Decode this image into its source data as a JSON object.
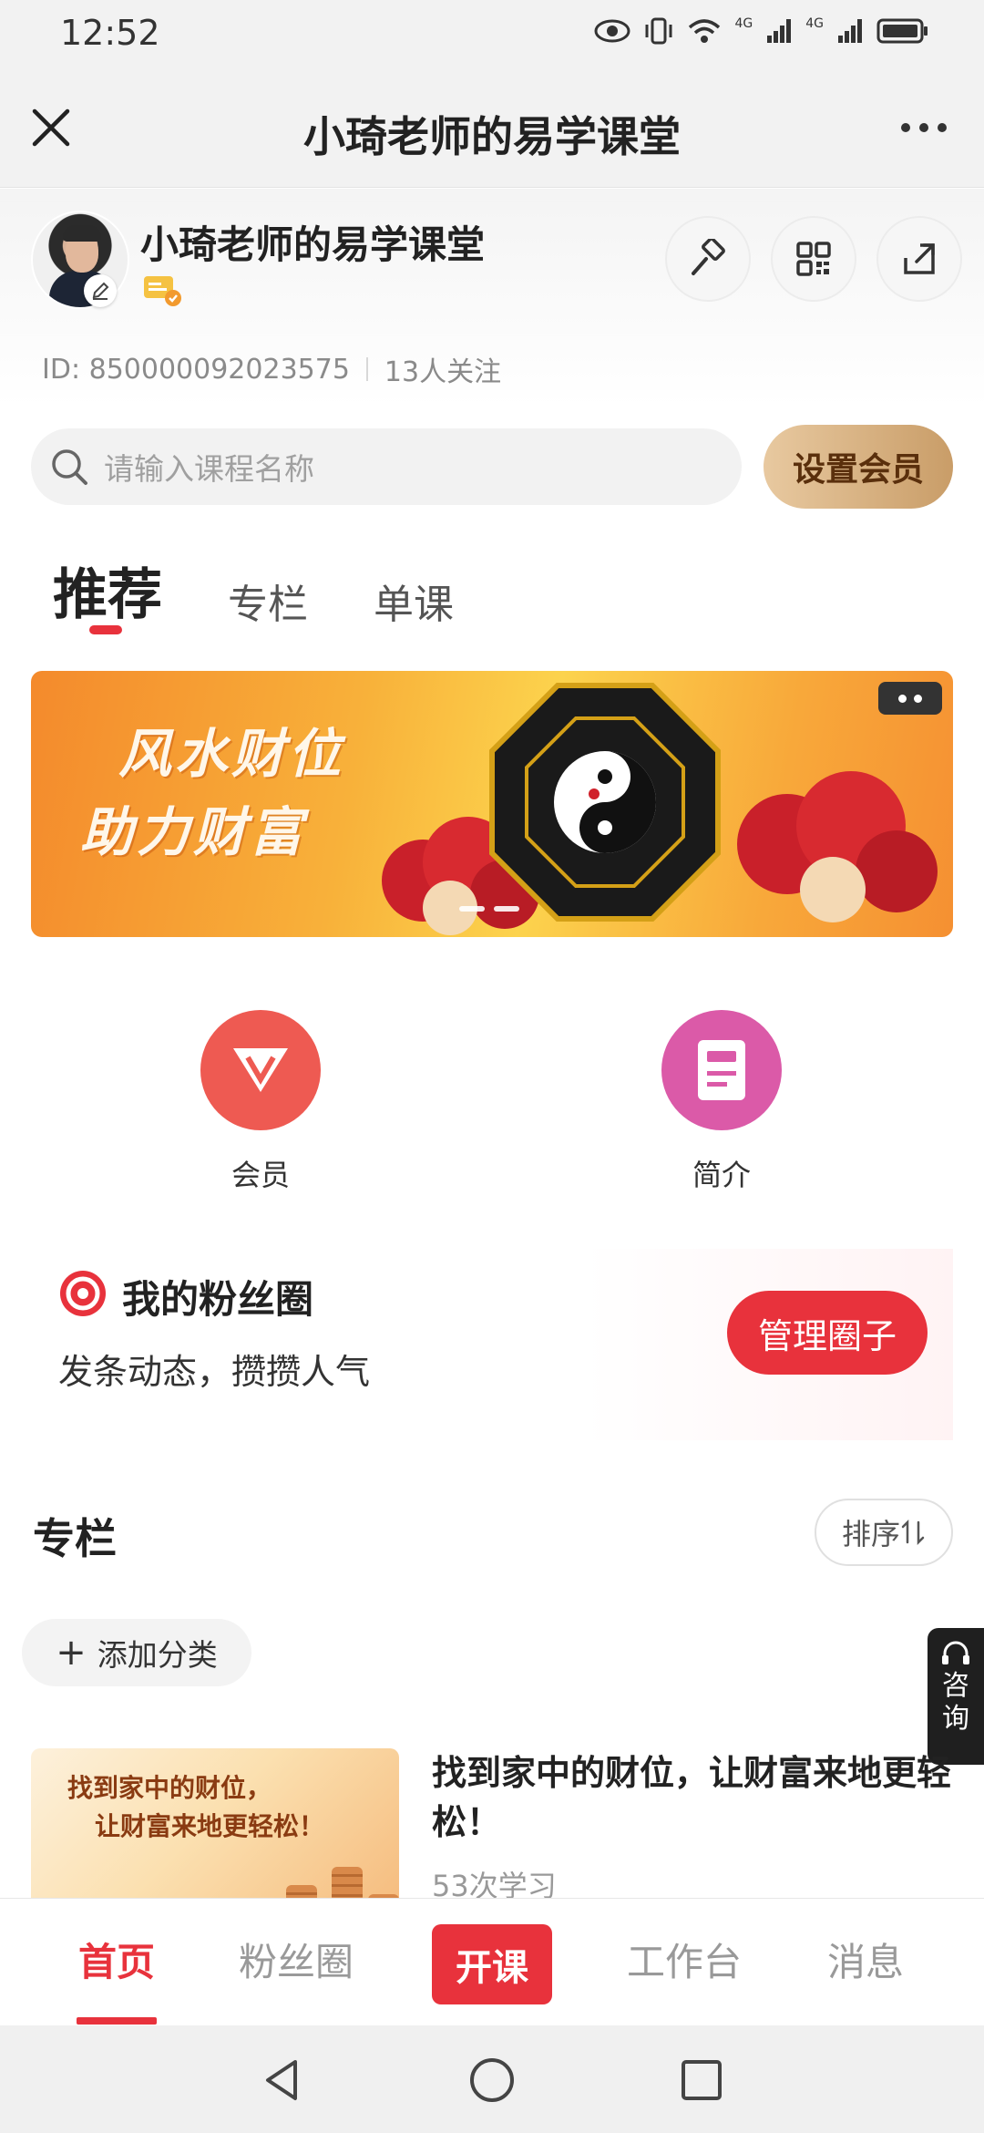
{
  "status_bar": {
    "time": "12:52",
    "network_1": "4G",
    "network_2": "4G",
    "icons": [
      "eye-icon",
      "vibrate-icon",
      "wifi-icon",
      "signal-icon",
      "signal-icon",
      "battery-icon"
    ]
  },
  "title_bar": {
    "title": "小琦老师的易学课堂",
    "icons": [
      "close-icon",
      "more-icon"
    ]
  },
  "profile": {
    "name": "小琦老师的易学课堂",
    "id_label": "ID:",
    "id_value": "850000092023575",
    "followers": "13人关注",
    "actions": [
      "hammer-icon",
      "qrcode-icon",
      "share-icon"
    ]
  },
  "search": {
    "placeholder": "请输入课程名称",
    "set_member_label": "设置会员"
  },
  "tabs": [
    {
      "label": "推荐",
      "active": true
    },
    {
      "label": "专栏",
      "active": false
    },
    {
      "label": "单课",
      "active": false
    }
  ],
  "banner": {
    "line1": "风水财位",
    "line2": "助力财富",
    "page_index": 2,
    "page_count": 2
  },
  "quick_links": [
    {
      "label": "会员",
      "icon": "vip-diamond-icon",
      "color": "#ee5a52"
    },
    {
      "label": "简介",
      "icon": "book-icon",
      "color": "#db5aa8"
    }
  ],
  "fans_circle": {
    "title": "我的粉丝圈",
    "subtitle": "发条动态，攒攒人气",
    "button": "管理圈子"
  },
  "column_section": {
    "title": "专栏",
    "sort_label": "排序",
    "add_category": "添加分类",
    "consult_label_1": "咨",
    "consult_label_2": "询"
  },
  "course": {
    "thumb_line1": "找到家中的财位，",
    "thumb_line2": "让财富来地更轻松！",
    "title": "找到家中的财位，让财富来地更轻松！",
    "study_count": "53次学习"
  },
  "bottom_tabs": [
    {
      "label": "首页",
      "active": true
    },
    {
      "label": "粉丝圈",
      "active": false
    },
    {
      "label": "开课",
      "active": false
    },
    {
      "label": "工作台",
      "active": false
    },
    {
      "label": "消息",
      "active": false
    }
  ],
  "colors": {
    "accent": "#e8323c",
    "gold_start": "#e8c9a0",
    "gold_end": "#c99d68"
  }
}
